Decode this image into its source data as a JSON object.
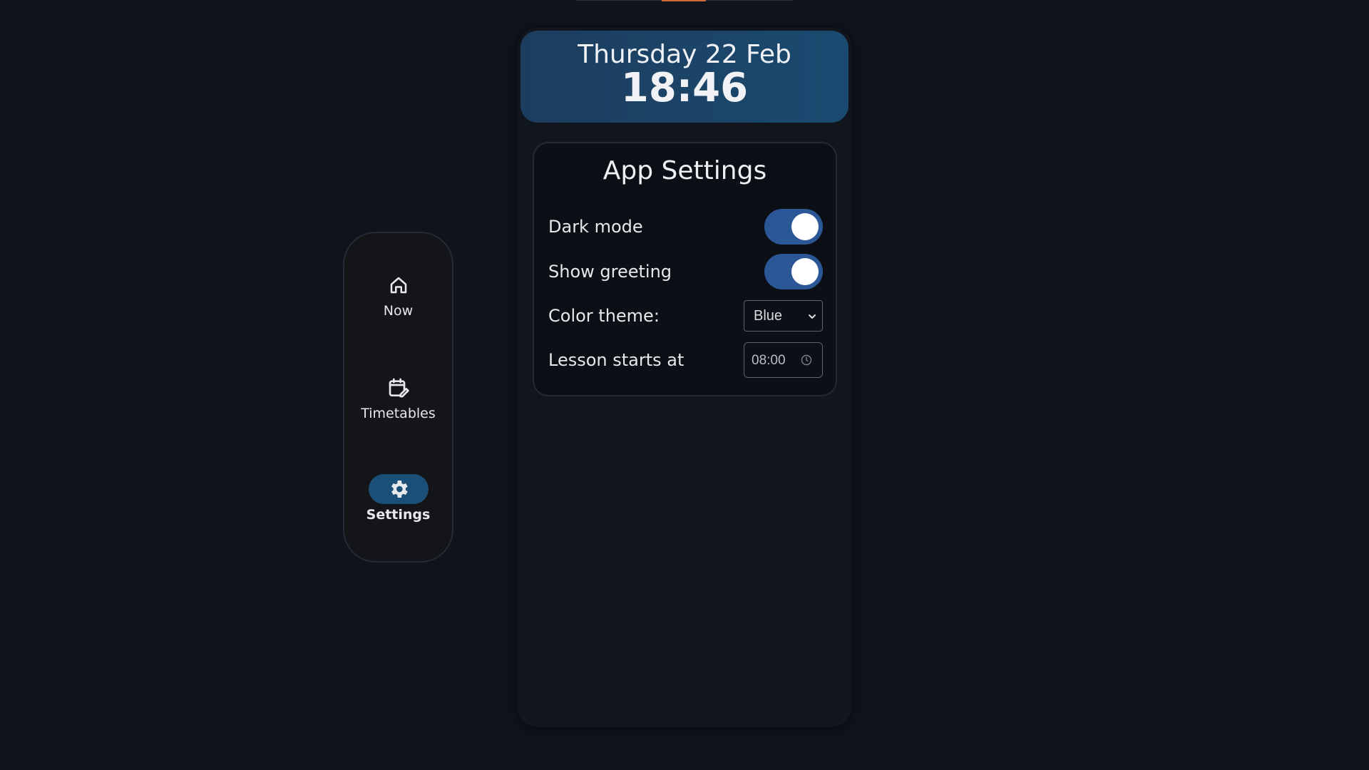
{
  "nav": {
    "items": [
      {
        "label": "Now",
        "icon": "home-icon",
        "active": false
      },
      {
        "label": "Timetables",
        "icon": "calendar-edit-icon",
        "active": false
      },
      {
        "label": "Settings",
        "icon": "gear-icon",
        "active": true
      }
    ]
  },
  "clock": {
    "date": "Thursday 22 Feb",
    "time": "18:46"
  },
  "settings": {
    "title": "App Settings",
    "dark_mode": {
      "label": "Dark mode",
      "enabled": true
    },
    "show_greeting": {
      "label": "Show greeting",
      "enabled": true
    },
    "color_theme": {
      "label": "Color theme:",
      "value": "Blue"
    },
    "lesson_start": {
      "label": "Lesson starts at",
      "value": "08:00"
    }
  },
  "colors": {
    "background": "#0f141c",
    "accent": "#2b5797",
    "active_nav": "#1a4f78",
    "header_gradient_start": "#1d3d5e",
    "header_gradient_end": "#1a4a70",
    "top_indicator": "#d2683a"
  }
}
